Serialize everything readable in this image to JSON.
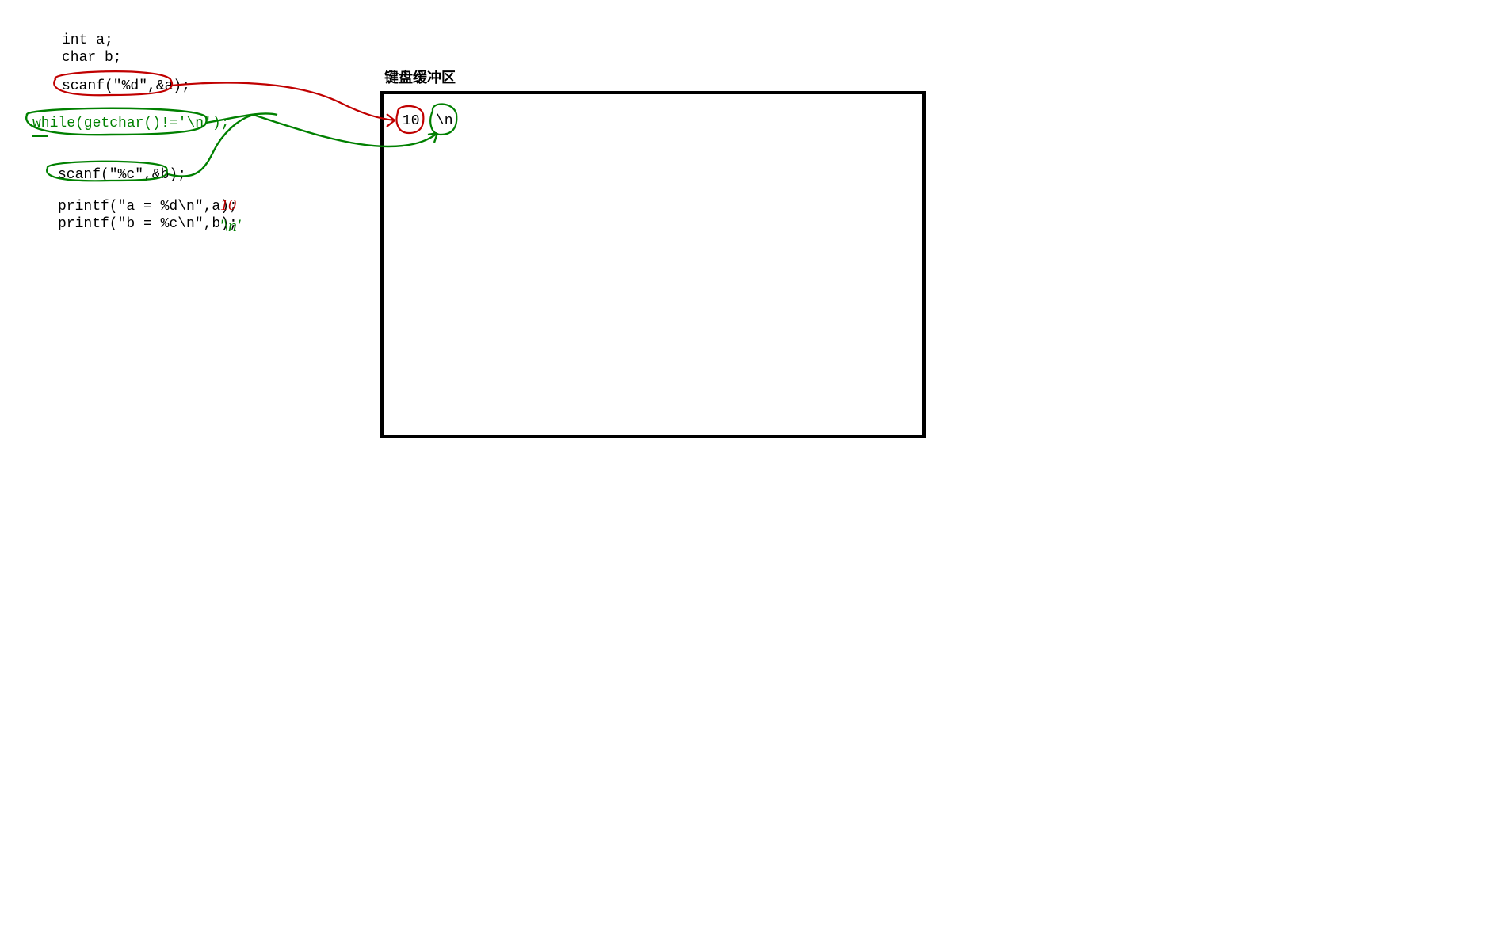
{
  "code": {
    "line1": "int a;",
    "line2": "char b;",
    "scanf_a": "scanf(\"%d\",&a);",
    "while_line": "while(getchar()!='\\n');",
    "scanf_b": "scanf(\"%c\",&b);",
    "printf_a": "printf(\"a = %d\\n\",a);",
    "printf_b": "printf(\"b = %c\\n\",b);"
  },
  "annotations": {
    "result_a": "10",
    "result_b": "'\\n'"
  },
  "buffer": {
    "label": "键盘缓冲区",
    "item1": "10",
    "item2": "\\n"
  }
}
